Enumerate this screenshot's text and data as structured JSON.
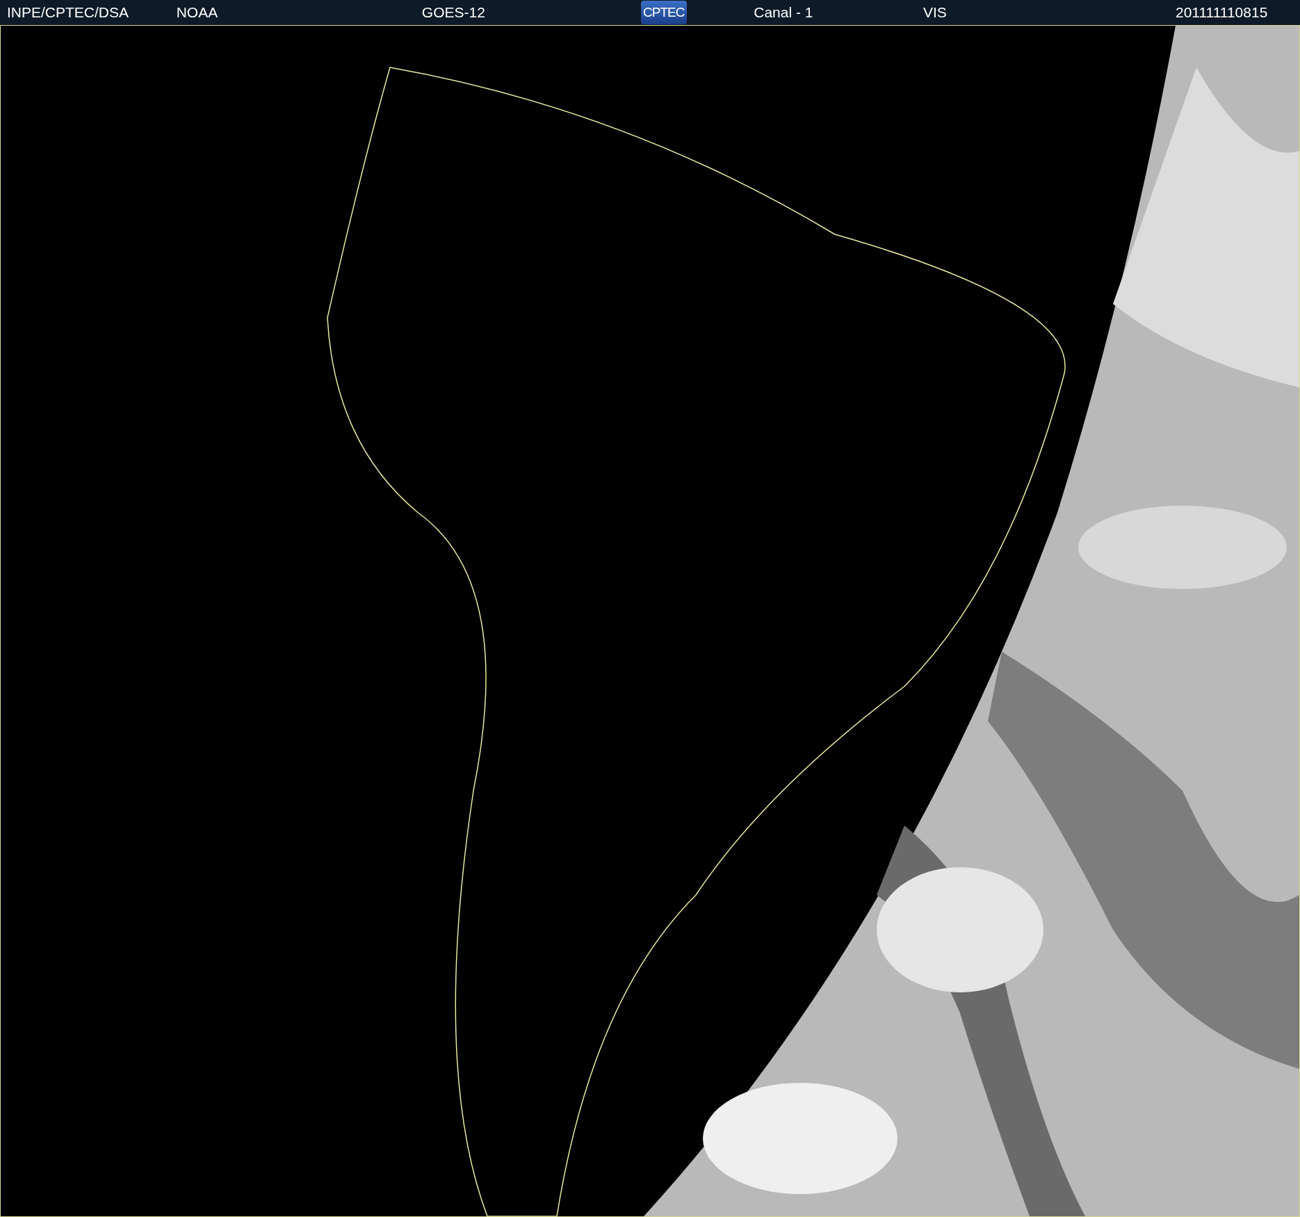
{
  "header": {
    "items": [
      {
        "kind": "text",
        "text": "INPE/CPTEC/DSA"
      },
      {
        "kind": "text",
        "text": "NOAA"
      },
      {
        "kind": "text",
        "text": "GOES-12"
      },
      {
        "kind": "logo",
        "text": "CPTEC"
      },
      {
        "kind": "text",
        "text": "Canal - 1"
      },
      {
        "kind": "text",
        "text": "VIS"
      },
      {
        "kind": "text",
        "text": "201111110815"
      }
    ]
  }
}
